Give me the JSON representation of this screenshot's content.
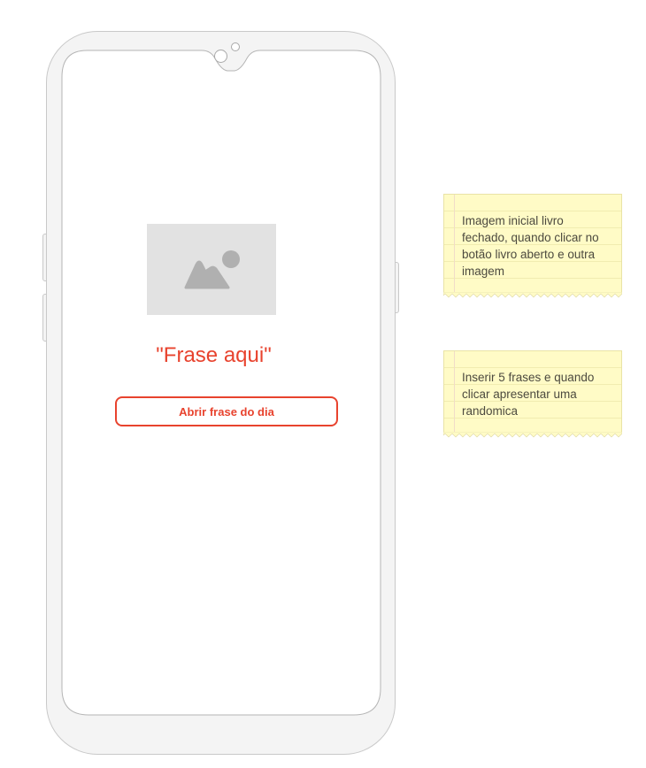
{
  "phone": {
    "image_placeholder_icon": "image-icon",
    "quote_text": "\"Frase aqui\"",
    "button_label": "Abrir frase do dia"
  },
  "notes": [
    {
      "text": "Imagem inicial livro fechado, quando clicar no botão livro aberto e outra imagem"
    },
    {
      "text": "Inserir 5 frases e quando clicar apresentar uma randomica"
    }
  ],
  "colors": {
    "accent": "#e8432e",
    "note_background": "#fffbc6",
    "placeholder_background": "#e2e2e2"
  }
}
